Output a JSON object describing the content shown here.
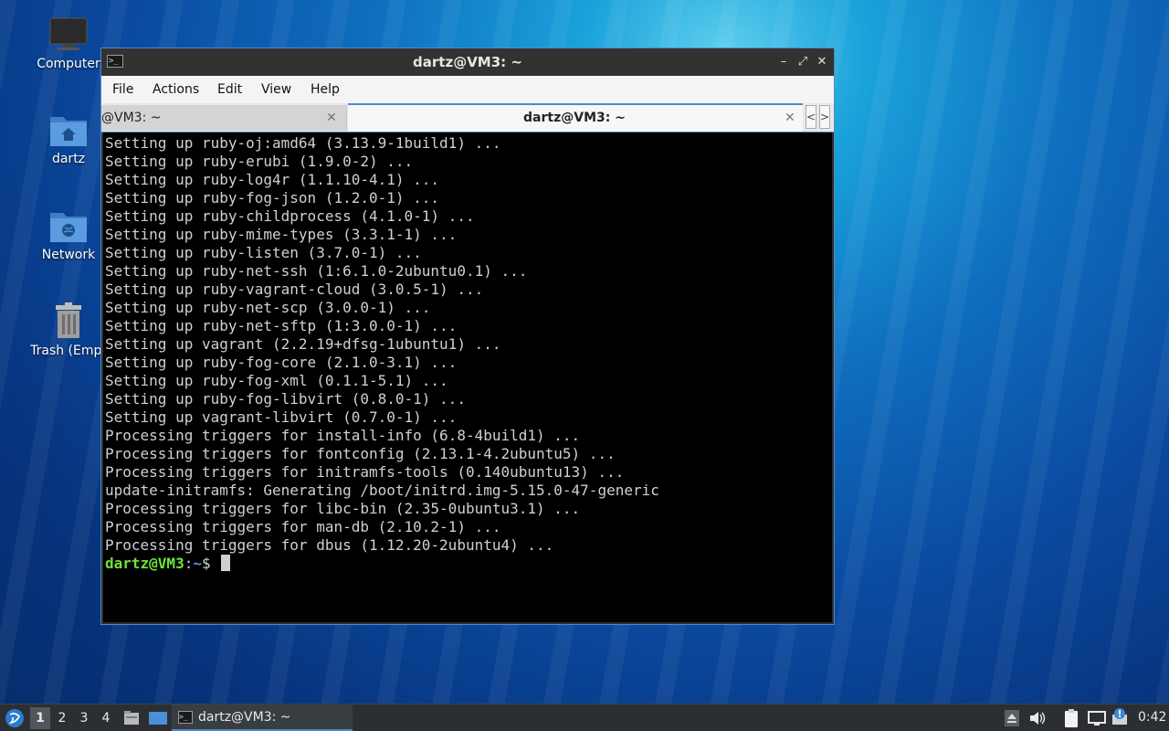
{
  "desktop": {
    "icons": [
      {
        "label": "Computer"
      },
      {
        "label": "dartz"
      },
      {
        "label": "Network"
      },
      {
        "label": "Trash (Empt"
      }
    ]
  },
  "window": {
    "title": "dartz@VM3: ~",
    "buttons": {
      "minimize": "–",
      "maximize": "⤢",
      "close": "✕"
    },
    "menu": [
      "File",
      "Actions",
      "Edit",
      "View",
      "Help"
    ],
    "tabs": [
      {
        "label": "@VM3: ~",
        "close": "✕"
      },
      {
        "label": "dartz@VM3: ~",
        "close": "✕"
      }
    ],
    "tab_scroll": {
      "left": "<",
      "right": ">"
    }
  },
  "terminal": {
    "lines": [
      "Setting up ruby-oj:amd64 (3.13.9-1build1) ...",
      "Setting up ruby-erubi (1.9.0-2) ...",
      "Setting up ruby-log4r (1.1.10-4.1) ...",
      "Setting up ruby-fog-json (1.2.0-1) ...",
      "Setting up ruby-childprocess (4.1.0-1) ...",
      "Setting up ruby-mime-types (3.3.1-1) ...",
      "Setting up ruby-listen (3.7.0-1) ...",
      "Setting up ruby-net-ssh (1:6.1.0-2ubuntu0.1) ...",
      "Setting up ruby-vagrant-cloud (3.0.5-1) ...",
      "Setting up ruby-net-scp (3.0.0-1) ...",
      "Setting up ruby-net-sftp (1:3.0.0-1) ...",
      "Setting up vagrant (2.2.19+dfsg-1ubuntu1) ...",
      "Setting up ruby-fog-core (2.1.0-3.1) ...",
      "Setting up ruby-fog-xml (0.1.1-5.1) ...",
      "Setting up ruby-fog-libvirt (0.8.0-1) ...",
      "Setting up vagrant-libvirt (0.7.0-1) ...",
      "Processing triggers for install-info (6.8-4build1) ...",
      "Processing triggers for fontconfig (2.13.1-4.2ubuntu5) ...",
      "Processing triggers for initramfs-tools (0.140ubuntu13) ...",
      "update-initramfs: Generating /boot/initrd.img-5.15.0-47-generic",
      "Processing triggers for libc-bin (2.35-0ubuntu3.1) ...",
      "Processing triggers for man-db (2.10.2-1) ...",
      "Processing triggers for dbus (1.12.20-2ubuntu4) ..."
    ],
    "prompt": {
      "user": "dartz@VM3",
      "sep": ":",
      "path": "~",
      "symbol": "$ "
    }
  },
  "taskbar": {
    "workspaces": [
      "1",
      "2",
      "3",
      "4"
    ],
    "task": {
      "label": "dartz@VM3: ~"
    },
    "clock": "0:42"
  },
  "colors": {
    "accent": "#4d89c7",
    "prompt_user": "#6ee33a",
    "prompt_path": "#5f8fe8",
    "terminal_bg": "#000000"
  }
}
